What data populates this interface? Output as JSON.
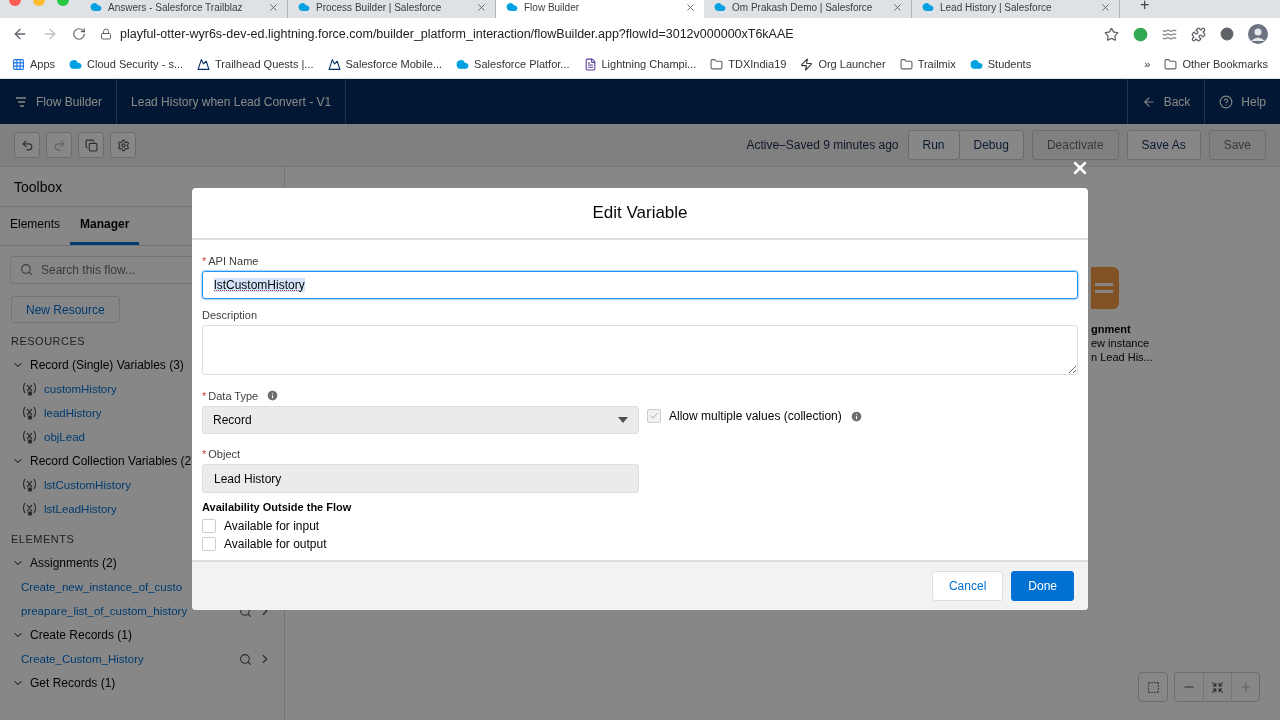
{
  "browser": {
    "tabs": [
      {
        "title": "Answers - Salesforce Trailblaz",
        "selected": false
      },
      {
        "title": "Process Builder | Salesforce",
        "selected": false
      },
      {
        "title": "Flow Builder",
        "selected": true
      },
      {
        "title": "Om Prakash Demo | Salesforce",
        "selected": false
      },
      {
        "title": "Lead History | Salesforce",
        "selected": false
      }
    ],
    "new_tab": "+",
    "url": "playful-otter-wyr6s-dev-ed.lightning.force.com/builder_platform_interaction/flowBuilder.app?flowId=3012v000000xT6kAAE",
    "bookmarks": [
      {
        "label": "Apps",
        "kind": "apps"
      },
      {
        "label": "Cloud Security - s...",
        "kind": "cloud"
      },
      {
        "label": "Trailhead Quests |...",
        "kind": "trail"
      },
      {
        "label": "Salesforce Mobile...",
        "kind": "trail"
      },
      {
        "label": "Salesforce Platfor...",
        "kind": "cloud"
      },
      {
        "label": "Lightning Champi...",
        "kind": "page"
      },
      {
        "label": "TDXIndia19",
        "kind": "folder"
      },
      {
        "label": "Org Launcher",
        "kind": "bolt"
      },
      {
        "label": "Trailmix",
        "kind": "folder"
      },
      {
        "label": "Students",
        "kind": "cloud"
      }
    ],
    "more": "»",
    "other_bookmarks": "Other Bookmarks"
  },
  "app_header": {
    "app": "Flow Builder",
    "flow_title": "Lead History when Lead Convert - V1",
    "back": "Back",
    "help": "Help"
  },
  "toolbar": {
    "status": "Active–Saved 9 minutes ago",
    "buttons": [
      {
        "label": "Run",
        "disabled": false
      },
      {
        "label": "Debug",
        "disabled": false
      },
      {
        "label": "Deactivate",
        "disabled": true
      },
      {
        "label": "Save As",
        "disabled": false
      },
      {
        "label": "Save",
        "disabled": true
      }
    ]
  },
  "toolbox": {
    "title": "Toolbox",
    "tabs": [
      {
        "label": "Elements",
        "selected": false
      },
      {
        "label": "Manager",
        "selected": true
      }
    ],
    "search": {
      "placeholder": "Search this flow..."
    },
    "new_resource": "New Resource",
    "sections": [
      {
        "heading": "RESOURCES",
        "groups": [
          {
            "label": "Record (Single) Variables (3)",
            "expanded": true,
            "items": [
              {
                "label": "customHistory",
                "kind": "variable"
              },
              {
                "label": "leadHistory",
                "kind": "variable"
              },
              {
                "label": "objLead",
                "kind": "variable"
              }
            ]
          },
          {
            "label": "Record Collection Variables (2",
            "expanded": true,
            "items": [
              {
                "label": "lstCustomHistory",
                "kind": "variable"
              },
              {
                "label": "lstLeadHistory",
                "kind": "variable"
              }
            ]
          }
        ]
      },
      {
        "heading": "ELEMENTS",
        "groups": [
          {
            "label": "Assignments (2)",
            "expanded": true,
            "items": [
              {
                "label": "Create_new_instance_of_custo",
                "kind": "link"
              },
              {
                "label": "preapare_list_of_custom_history",
                "kind": "element"
              }
            ]
          },
          {
            "label": "Create Records (1)",
            "expanded": true,
            "items": [
              {
                "label": "Create_Custom_History",
                "kind": "element"
              }
            ]
          },
          {
            "label": "Get Records (1)",
            "expanded": true
          }
        ]
      }
    ]
  },
  "canvas": {
    "node": {
      "title": "gnment",
      "lines": [
        "ew instance",
        "n Lead His..."
      ]
    }
  },
  "modal": {
    "title": "Edit Variable",
    "api_name": {
      "label": "API Name",
      "required_mark": "*",
      "value": "lstCustomHistory"
    },
    "description": {
      "label": "Description"
    },
    "data_type": {
      "label": "Data Type",
      "required_mark": "*",
      "value": "Record"
    },
    "allow_multiple": {
      "label": "Allow multiple values (collection)",
      "checked": true,
      "disabled": true
    },
    "object": {
      "label": "Object",
      "required_mark": "*",
      "value": "Lead History"
    },
    "availability": {
      "heading": "Availability Outside the Flow",
      "options": [
        {
          "label": "Available for input",
          "checked": false
        },
        {
          "label": "Available for output",
          "checked": false
        }
      ]
    },
    "buttons": [
      {
        "label": "Cancel",
        "kind": "neutral"
      },
      {
        "label": "Done",
        "kind": "brand"
      }
    ]
  }
}
